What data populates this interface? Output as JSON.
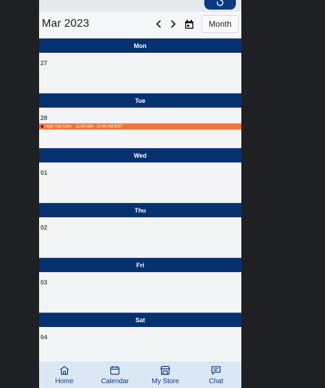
{
  "header": {
    "month_title": "Mar 2023",
    "view_label": "Month"
  },
  "days": [
    {
      "weekday": "Mon",
      "date": "27"
    },
    {
      "weekday": "Tue",
      "date": "28",
      "event": {
        "title": "High Top Corn",
        "time": "11:00 AM - 11:40 AM EST",
        "color": "#f2743a"
      }
    },
    {
      "weekday": "Wed",
      "date": "01"
    },
    {
      "weekday": "Thu",
      "date": "02"
    },
    {
      "weekday": "Fri",
      "date": "03"
    },
    {
      "weekday": "Sat",
      "date": "04"
    }
  ],
  "bottom_nav": [
    {
      "label": "Home",
      "icon": "home-icon"
    },
    {
      "label": "Calendar",
      "icon": "calendar-icon"
    },
    {
      "label": "My Store",
      "icon": "store-icon"
    },
    {
      "label": "Chat",
      "icon": "chat-icon"
    }
  ],
  "colors": {
    "primary": "#06316f",
    "event": "#f2743a",
    "nav_bg": "#dbe7f5"
  }
}
